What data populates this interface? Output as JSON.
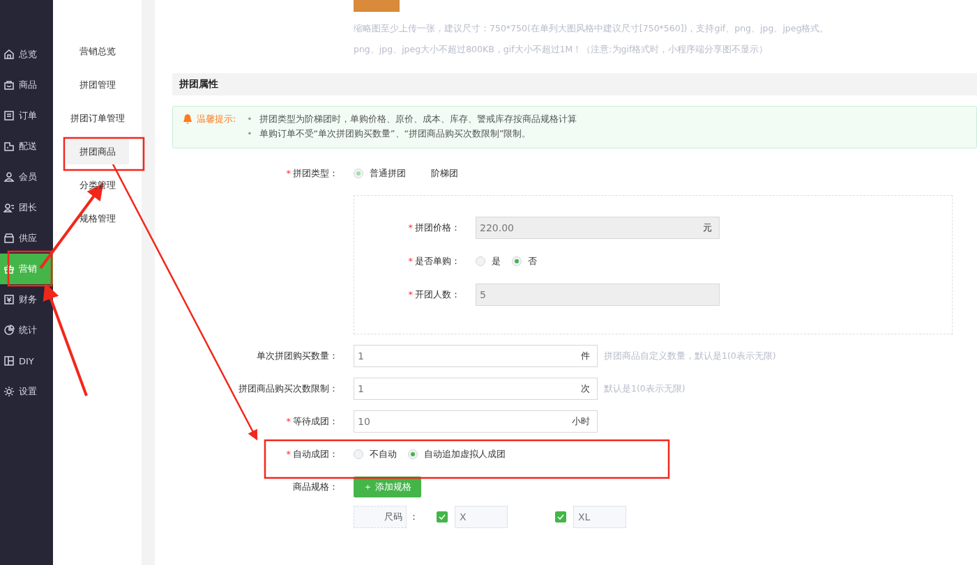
{
  "sidebar": {
    "items": [
      {
        "label": "总览",
        "selected": false
      },
      {
        "label": "商品",
        "selected": false
      },
      {
        "label": "订单",
        "selected": false
      },
      {
        "label": "配送",
        "selected": false
      },
      {
        "label": "会员",
        "selected": false
      },
      {
        "label": "团长",
        "selected": false
      },
      {
        "label": "供应",
        "selected": false
      },
      {
        "label": "营销",
        "selected": true
      },
      {
        "label": "财务",
        "selected": false
      },
      {
        "label": "统计",
        "selected": false
      },
      {
        "label": "DIY",
        "selected": false
      },
      {
        "label": "设置",
        "selected": false
      }
    ]
  },
  "subnav": {
    "items": [
      {
        "label": "营销总览",
        "selected": false
      },
      {
        "label": "拼团管理",
        "selected": false
      },
      {
        "label": "拼团订单管理",
        "selected": false
      },
      {
        "label": "拼团商品",
        "selected": true
      },
      {
        "label": "分类管理",
        "selected": false
      },
      {
        "label": "规格管理",
        "selected": false
      }
    ]
  },
  "image_hints": [
    "缩略图至少上传一张，建议尺寸：750*750(在单列大图风格中建议尺寸[750*560])，支持gif、png、jpg、jpeg格式。",
    "png、jpg、jpeg大小不超过800KB，gif大小不超过1M！（注意:为gif格式时，小程序端分享图不显示）"
  ],
  "section_title": "拼团属性",
  "tip": {
    "label": "温馨提示:",
    "bullet": "•",
    "lines": [
      "拼团类型为阶梯团时，单购价格、原价、成本、库存、警戒库存按商品规格计算",
      "单购订单不受“单次拼团购买数量”、“拼团商品购买次数限制”限制。"
    ]
  },
  "group_type": {
    "label": "拼团类型：",
    "required_mark": "*",
    "options": [
      {
        "kind": "radio",
        "label": "普通拼团",
        "selected": true,
        "disabled": true
      },
      {
        "kind": "label",
        "label": "阶梯团"
      }
    ]
  },
  "inner_fields": [
    {
      "kind": "input",
      "label": "拼团价格：",
      "required_mark": "*",
      "value": "220.00",
      "suffix": "元"
    },
    {
      "kind": "radios",
      "label": "是否单购：",
      "required_mark": "*",
      "options": [
        {
          "label": "是",
          "selected": false
        },
        {
          "label": "否",
          "selected": true
        }
      ]
    },
    {
      "kind": "input",
      "label": "开团人数：",
      "required_mark": "*",
      "value": "5"
    }
  ],
  "fields": [
    {
      "kind": "input",
      "label": "单次拼团购买数量：",
      "value": "1",
      "suffix": "件",
      "hint": "拼团商品自定义数量，默认是1(0表示无限)"
    },
    {
      "kind": "input",
      "label": "拼团商品购买次数限制：",
      "value": "1",
      "suffix": "次",
      "hint": "默认是1(0表示无限)"
    },
    {
      "kind": "input",
      "label": "等待成团：",
      "required_mark": "*",
      "value": "10",
      "suffix": "小时"
    },
    {
      "kind": "radios",
      "label": "自动成团：",
      "required_mark": "*",
      "options": [
        {
          "label": "不自动",
          "selected": false
        },
        {
          "label": "自动追加虚拟人成团",
          "selected": true
        }
      ]
    },
    {
      "kind": "button",
      "label": "商品规格：",
      "button": "＋ 添加规格"
    }
  ],
  "spec": {
    "name": "尺码",
    "colon": "：",
    "values": [
      {
        "value": "X",
        "checked": true
      },
      {
        "value": "XL",
        "checked": true
      }
    ]
  }
}
